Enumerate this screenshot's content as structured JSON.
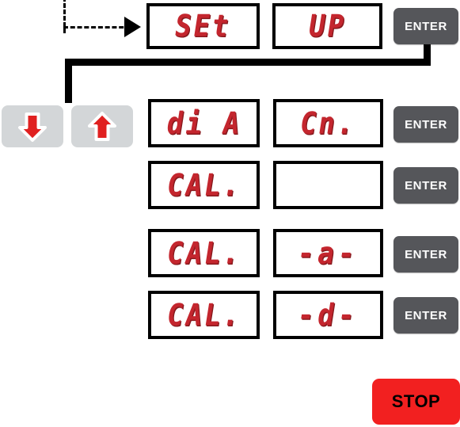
{
  "colors": {
    "lcd_red": "#c4262e",
    "enter_button": "#55565a",
    "stop_button": "#f22020",
    "arrow_key": "#d3d6d8",
    "arrow_glyph": "#e02020",
    "line": "#000000",
    "background": "#ffffff"
  },
  "keys": {
    "enter_label": "ENTER",
    "stop_label": "STOP",
    "down_arrow_icon": "arrow-down-icon",
    "up_arrow_icon": "arrow-up-icon"
  },
  "flow": {
    "rows": [
      {
        "id": "row-set-up",
        "left_display": "SEt",
        "right_display": "UP",
        "enter_label": "ENTER"
      },
      {
        "id": "row-dia-cn",
        "left_display": "di A",
        "right_display": "Cn.",
        "enter_label": "ENTER"
      },
      {
        "id": "row-cal-blank",
        "left_display": "CAL.",
        "right_display": "",
        "enter_label": "ENTER"
      },
      {
        "id": "row-cal-a",
        "left_display": "CAL.",
        "right_display": "-a-",
        "enter_label": "ENTER"
      },
      {
        "id": "row-cal-d",
        "left_display": "CAL.",
        "right_display": "-d-",
        "enter_label": "ENTER"
      }
    ]
  }
}
